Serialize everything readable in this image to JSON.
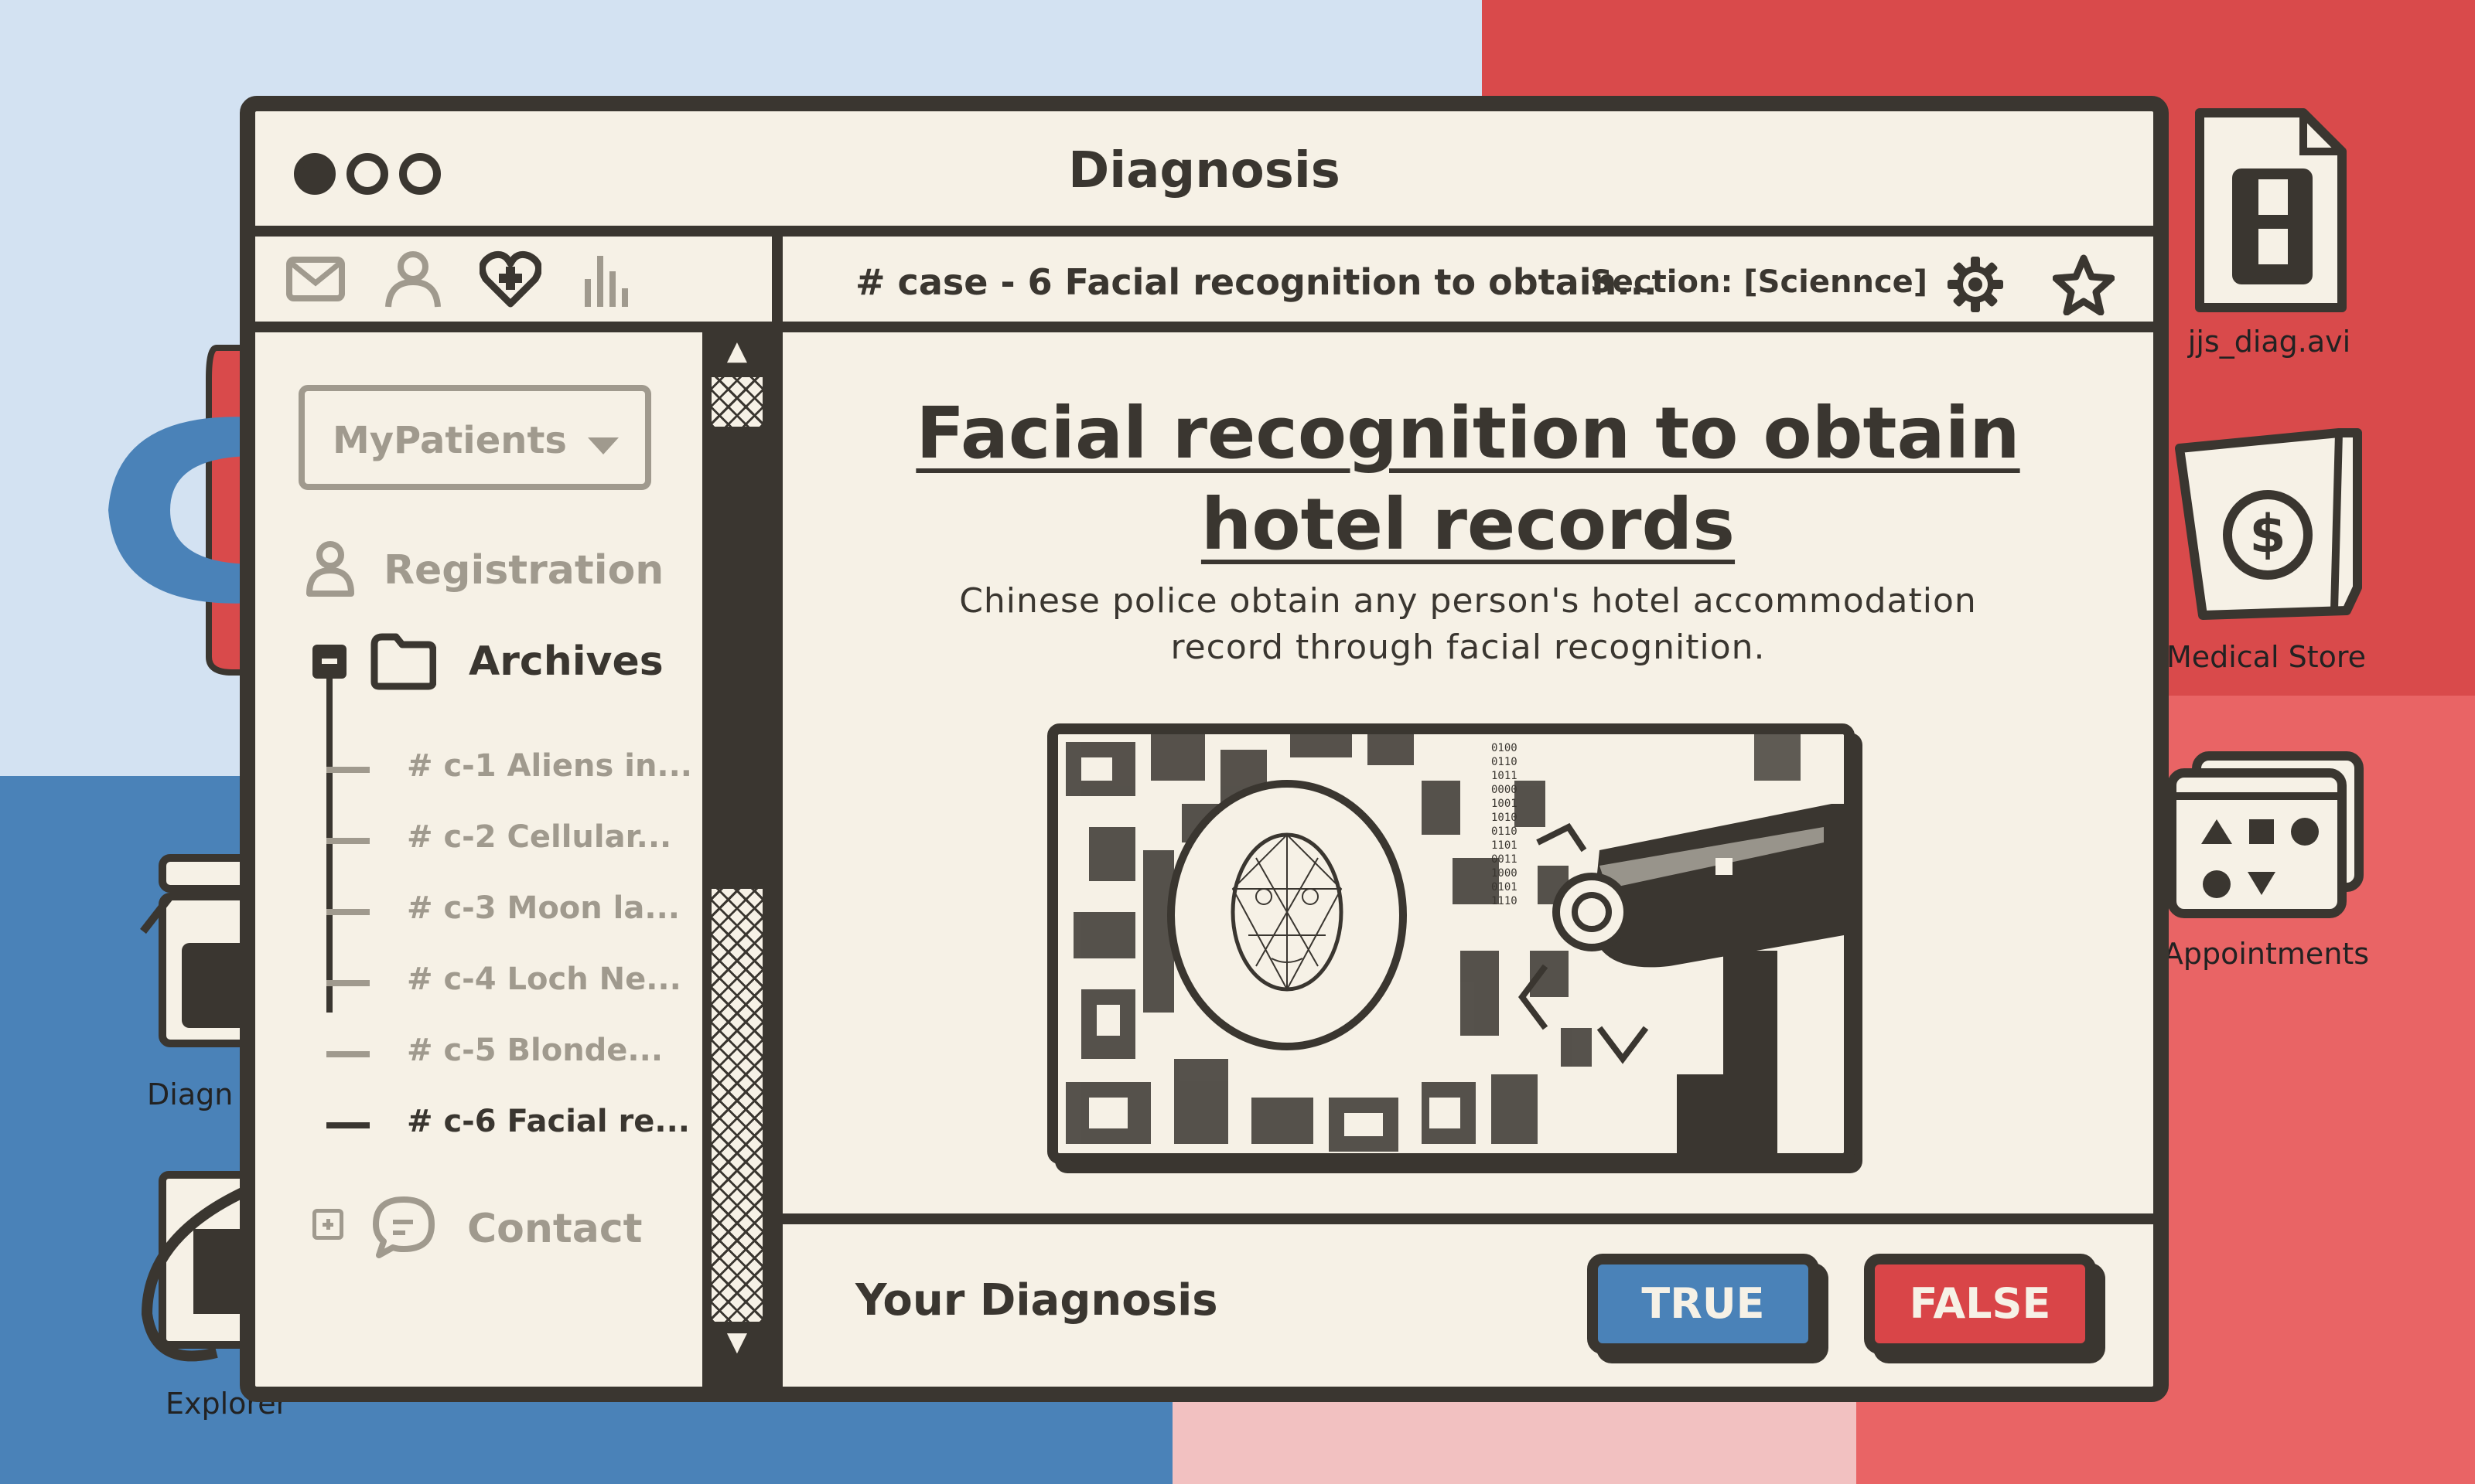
{
  "window": {
    "title": "Diagnosis"
  },
  "desktop": {
    "icons": [
      {
        "label": "jjs_diag.avi",
        "icon": "film-file-icon"
      },
      {
        "label": "Medical Store",
        "icon": "shopping-bag-dollar-icon"
      },
      {
        "label": "Appointments",
        "icon": "folder-shapes-icon"
      },
      {
        "label": "Diagn",
        "icon": "medicine-jar-icon"
      },
      {
        "label": "Explorer",
        "icon": "explorer-icon"
      }
    ]
  },
  "sidebar": {
    "tabs": [
      "mail-icon",
      "user-icon",
      "heart-plus-icon",
      "bar-chart-icon"
    ],
    "dropdown": {
      "value": "MyPatients"
    },
    "registration": "Registration",
    "archives": "Archives",
    "cases": [
      "# c-1 Aliens in...",
      "# c-2 Cellular...",
      "# c-3 Moon la...",
      "# c-4 Loch Ne...",
      "# c-5 Blonde...",
      "# c-6 Facial re..."
    ],
    "contact": "Contact"
  },
  "main": {
    "case_title": "# case - 6 Facial recognition to obtain...",
    "section": "Section: [Sciennce]",
    "headline_line1": "Facial recognition to obtain",
    "headline_line2": "hotel records",
    "description": "Chinese police obtain any person's hotel accommodation record through facial recognition.",
    "image_icon": "facial-recognition-surveillance-image",
    "diagnosis_label": "Your Diagnosis",
    "true_label": "TRUE",
    "false_label": "FALSE"
  },
  "colors": {
    "ink": "#3a3630",
    "paper": "#f6f1e6",
    "true_blue": "#4a82b8",
    "false_red": "#d94548",
    "muted": "#a09a8e"
  }
}
